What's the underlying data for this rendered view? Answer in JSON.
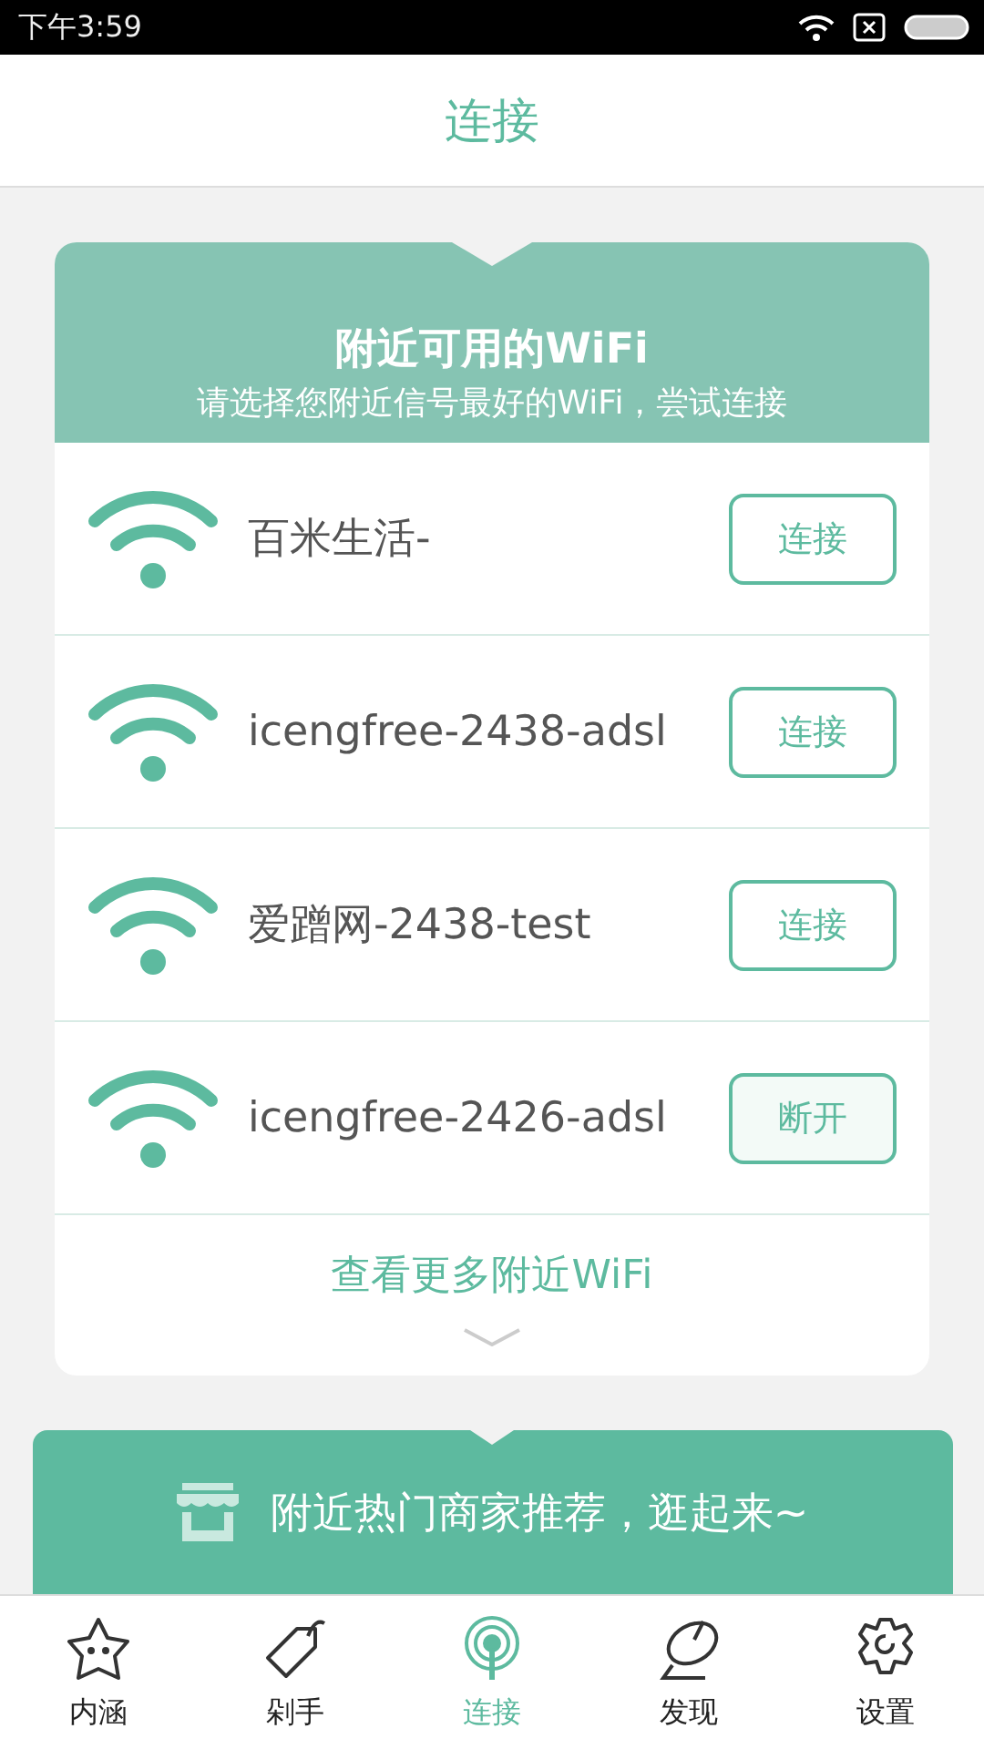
{
  "status_bar": {
    "time": "下午3:59"
  },
  "header": {
    "title": "连接"
  },
  "wifi_card": {
    "title": "附近可用的WiFi",
    "subtitle": "请选择您附近信号最好的WiFi，尝试连接",
    "networks": [
      {
        "name": "百米生活-",
        "action": "连接",
        "connected": false
      },
      {
        "name": "icengfree-2438-adsl",
        "action": "连接",
        "connected": false
      },
      {
        "name": "爱蹭网-2438-test",
        "action": "连接",
        "connected": false
      },
      {
        "name": "icengfree-2426-adsl",
        "action": "断开",
        "connected": true
      }
    ],
    "more_link": "查看更多附近WiFi"
  },
  "merchant_banner": {
    "text": "附近热门商家推荐，逛起来~"
  },
  "tabs": [
    {
      "label": "内涵",
      "kind": "star",
      "selected": false
    },
    {
      "label": "剁手",
      "kind": "tag",
      "selected": false
    },
    {
      "label": "连接",
      "kind": "antenna",
      "selected": true
    },
    {
      "label": "发现",
      "kind": "dish",
      "selected": false
    },
    {
      "label": "设置",
      "kind": "gear",
      "selected": false
    }
  ]
}
